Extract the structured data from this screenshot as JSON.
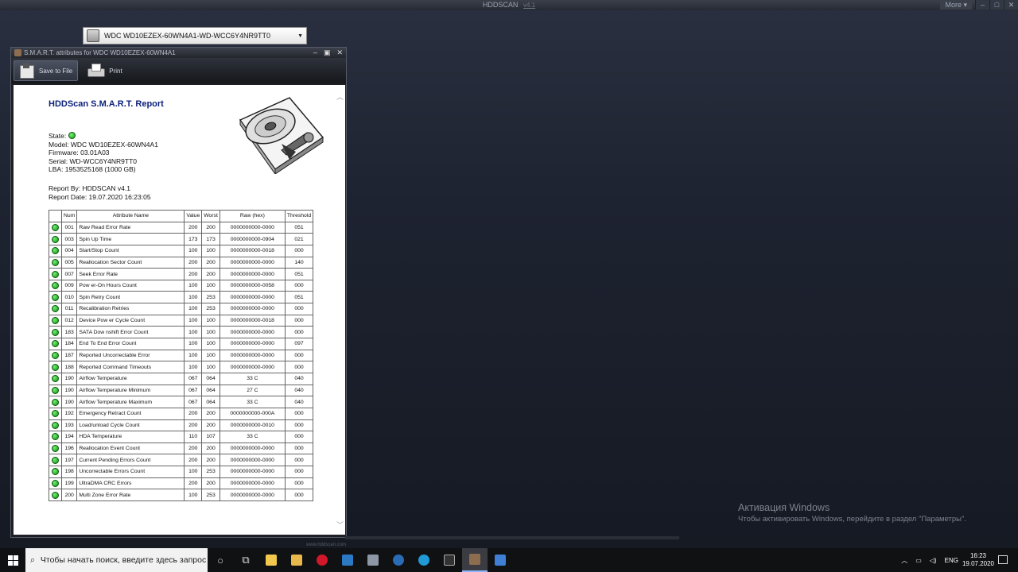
{
  "app": {
    "title": "HDDSCAN",
    "version": "v4.1",
    "more_label": "More ▾",
    "footer": "www.hddscan.com"
  },
  "drive_selector": {
    "value": "WDC WD10EZEX-60WN4A1-WD-WCC6Y4NR9TT0"
  },
  "smart_window": {
    "title": "S.M.A.R.T. attributes for WDC WD10EZEX-60WN4A1",
    "toolbar": {
      "save_label": "Save to File",
      "print_label": "Print"
    }
  },
  "report": {
    "title": "HDDScan S.M.A.R.T. Report",
    "state_label": "State:",
    "model": "Model: WDC WD10EZEX-60WN4A1",
    "firmware": "Firmware: 03.01A03",
    "serial": "Serial: WD-WCC6Y4NR9TT0",
    "lba": "LBA: 1953525168 (1000 GB)",
    "report_by": "Report By: HDDSCAN v4.1",
    "report_date": "Report Date: 19.07.2020 16:23:05",
    "columns": [
      "",
      "Num",
      "Attribute Name",
      "Value",
      "Worst",
      "Raw (hex)",
      "Threshold"
    ],
    "rows": [
      [
        "001",
        "Raw Read Error Rate",
        "200",
        "200",
        "0000000000-0000",
        "051"
      ],
      [
        "003",
        "Spin Up Time",
        "173",
        "173",
        "0000000000-0904",
        "021"
      ],
      [
        "004",
        "Start/Stop Count",
        "100",
        "100",
        "0000000000-0018",
        "000"
      ],
      [
        "005",
        "Reallocation Sector Count",
        "200",
        "200",
        "0000000000-0000",
        "140"
      ],
      [
        "007",
        "Seek Error Rate",
        "200",
        "200",
        "0000000000-0000",
        "051"
      ],
      [
        "009",
        "Pow er-On Hours Count",
        "100",
        "100",
        "0000000000-0058",
        "000"
      ],
      [
        "010",
        "Spin Retry Count",
        "100",
        "253",
        "0000000000-0000",
        "051"
      ],
      [
        "011",
        "Recalibration Retries",
        "100",
        "253",
        "0000000000-0000",
        "000"
      ],
      [
        "012",
        "Device Pow er Cycle Count",
        "100",
        "100",
        "0000000000-0018",
        "000"
      ],
      [
        "183",
        "SATA Dow nshift Error Count",
        "100",
        "100",
        "0000000000-0000",
        "000"
      ],
      [
        "184",
        "End To End Error Count",
        "100",
        "100",
        "0000000000-0000",
        "097"
      ],
      [
        "187",
        "Reported Uncorrectable Error",
        "100",
        "100",
        "0000000000-0000",
        "000"
      ],
      [
        "188",
        "Reported Command Timeouts",
        "100",
        "100",
        "0000000000-0000",
        "000"
      ],
      [
        "190",
        "Airflow Temperature",
        "067",
        "064",
        "33 C",
        "040"
      ],
      [
        "190",
        "Airflow Temperature Minimum",
        "067",
        "064",
        "27 C",
        "040"
      ],
      [
        "190",
        "Airflow Temperature Maximum",
        "067",
        "064",
        "33 C",
        "040"
      ],
      [
        "192",
        "Emergency Retract Count",
        "200",
        "200",
        "0000000000-000A",
        "000"
      ],
      [
        "193",
        "Load/unload Cycle Count",
        "200",
        "200",
        "0000000000-0010",
        "000"
      ],
      [
        "194",
        "HDA Temperature",
        "110",
        "107",
        "33 C",
        "000"
      ],
      [
        "196",
        "Reallocation Event Count",
        "200",
        "200",
        "0000000000-0000",
        "000"
      ],
      [
        "197",
        "Current Pending Errors Count",
        "200",
        "200",
        "0000000000-0000",
        "000"
      ],
      [
        "198",
        "Uncorrectable Errors Count",
        "100",
        "253",
        "0000000000-0000",
        "000"
      ],
      [
        "199",
        "UltraDMA CRC Errors",
        "200",
        "200",
        "0000000000-0000",
        "000"
      ],
      [
        "200",
        "Multi Zone Error Rate",
        "100",
        "253",
        "0000000000-0000",
        "000"
      ]
    ]
  },
  "activation": {
    "title": "Активация Windows",
    "text": "Чтобы активировать Windows, перейдите в раздел \"Параметры\"."
  },
  "taskbar": {
    "search_placeholder": "Чтобы начать поиск, введите здесь запрос",
    "language": "ENG",
    "time": "16:23",
    "date": "19.07.2020"
  },
  "colors": {
    "ok_status": "#149a14",
    "report_title": "#0b1f7a"
  }
}
